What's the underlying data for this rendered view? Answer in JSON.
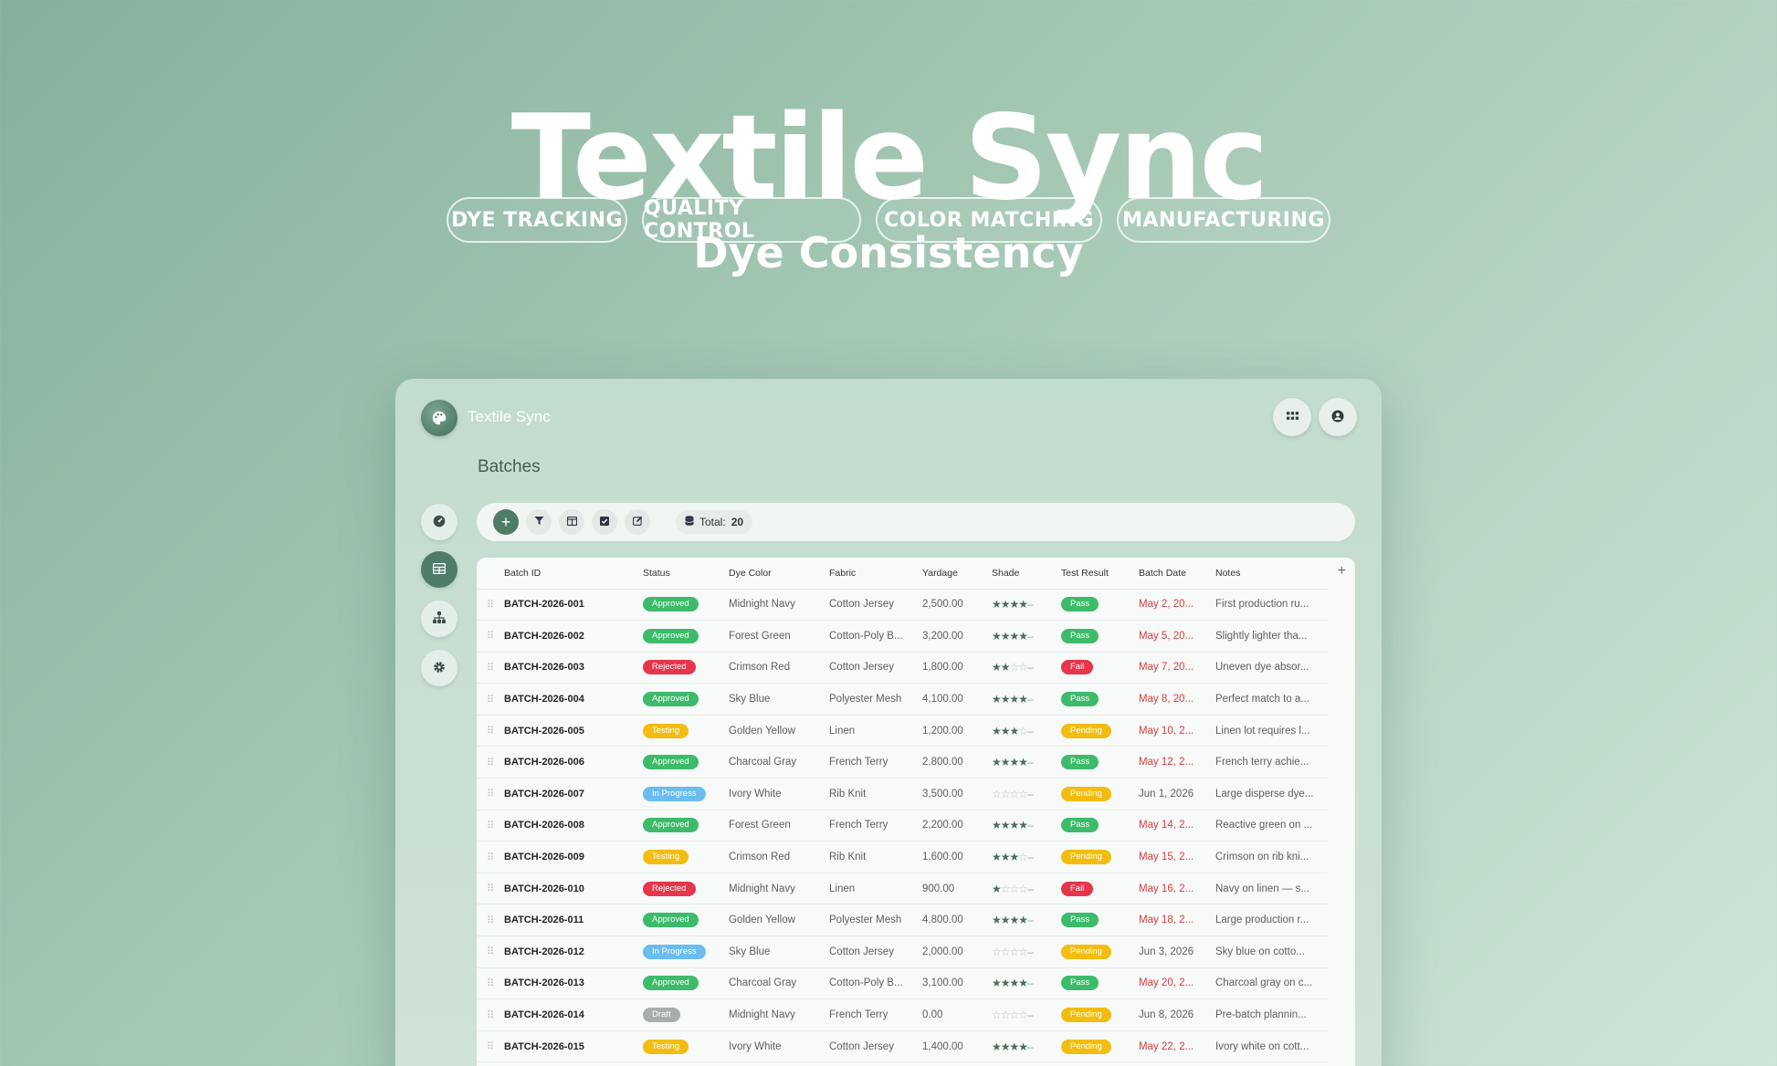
{
  "hero": {
    "title": "Textile Sync",
    "subtitle": "Dye Consistency",
    "tags": [
      "DYE TRACKING",
      "QUALITY CONTROL",
      "COLOR MATCHING",
      "MANUFACTURING"
    ]
  },
  "app": {
    "name": "Textile Sync",
    "page_title": "Batches",
    "total_label": "Total:",
    "total_value": "20",
    "add_column_label": "+"
  },
  "icons": {
    "logo": "palette-icon",
    "apps": "grid-icon",
    "account": "user-circle-icon",
    "sidebar": [
      "dashboard-icon",
      "table-icon",
      "hierarchy-icon",
      "settings-icon"
    ],
    "toolbar": [
      "plus-icon",
      "filter-icon",
      "columns-icon",
      "checkbox-icon",
      "edit-icon"
    ],
    "total": "database-icon"
  },
  "colors": {
    "accent": "#4f7c66",
    "Approved": "#3dbb6a",
    "Rejected": "#e5364b",
    "Testing": "#f2bd10",
    "In Progress": "#6bbcef",
    "Draft": "#a8aeaa",
    "Pass": "#3dbb6a",
    "Fail": "#e5364b",
    "Pending": "#f2bd10",
    "overdue_date": "#d83b3b"
  },
  "table": {
    "columns": [
      "Batch ID",
      "Status",
      "Dye Color",
      "Fabric",
      "Yardage",
      "Shade",
      "Test Result",
      "Batch Date",
      "Notes"
    ],
    "rows": [
      {
        "id": "BATCH-2026-001",
        "status": "Approved",
        "color": "Midnight Navy",
        "fabric": "Cotton Jersey",
        "yardage": "2,500.00",
        "shade": 4,
        "result": "Pass",
        "date": "May 2, 20...",
        "date_overdue": true,
        "notes": "First production ru..."
      },
      {
        "id": "BATCH-2026-002",
        "status": "Approved",
        "color": "Forest Green",
        "fabric": "Cotton-Poly B...",
        "yardage": "3,200.00",
        "shade": 4,
        "result": "Pass",
        "date": "May 5, 20...",
        "date_overdue": true,
        "notes": "Slightly lighter tha..."
      },
      {
        "id": "BATCH-2026-003",
        "status": "Rejected",
        "color": "Crimson Red",
        "fabric": "Cotton Jersey",
        "yardage": "1,800.00",
        "shade": 2,
        "result": "Fail",
        "date": "May 7, 20...",
        "date_overdue": true,
        "notes": "Uneven dye absor..."
      },
      {
        "id": "BATCH-2026-004",
        "status": "Approved",
        "color": "Sky Blue",
        "fabric": "Polyester Mesh",
        "yardage": "4,100.00",
        "shade": 4,
        "result": "Pass",
        "date": "May 8, 20...",
        "date_overdue": true,
        "notes": "Perfect match to a..."
      },
      {
        "id": "BATCH-2026-005",
        "status": "Testing",
        "color": "Golden Yellow",
        "fabric": "Linen",
        "yardage": "1,200.00",
        "shade": 3,
        "result": "Pending",
        "date": "May 10, 2...",
        "date_overdue": true,
        "notes": "Linen lot requires l..."
      },
      {
        "id": "BATCH-2026-006",
        "status": "Approved",
        "color": "Charcoal Gray",
        "fabric": "French Terry",
        "yardage": "2,800.00",
        "shade": 4,
        "result": "Pass",
        "date": "May 12, 2...",
        "date_overdue": true,
        "notes": "French terry achie..."
      },
      {
        "id": "BATCH-2026-007",
        "status": "In Progress",
        "color": "Ivory White",
        "fabric": "Rib Knit",
        "yardage": "3,500.00",
        "shade": 0,
        "result": "Pending",
        "date": "Jun 1, 2026",
        "date_overdue": false,
        "notes": "Large disperse dye..."
      },
      {
        "id": "BATCH-2026-008",
        "status": "Approved",
        "color": "Forest Green",
        "fabric": "French Terry",
        "yardage": "2,200.00",
        "shade": 4,
        "result": "Pass",
        "date": "May 14, 2...",
        "date_overdue": true,
        "notes": "Reactive green on ..."
      },
      {
        "id": "BATCH-2026-009",
        "status": "Testing",
        "color": "Crimson Red",
        "fabric": "Rib Knit",
        "yardage": "1,600.00",
        "shade": 3,
        "result": "Pending",
        "date": "May 15, 2...",
        "date_overdue": true,
        "notes": "Crimson on rib kni..."
      },
      {
        "id": "BATCH-2026-010",
        "status": "Rejected",
        "color": "Midnight Navy",
        "fabric": "Linen",
        "yardage": "900.00",
        "shade": 1,
        "result": "Fail",
        "date": "May 16, 2...",
        "date_overdue": true,
        "notes": "Navy on linen — s..."
      },
      {
        "id": "BATCH-2026-011",
        "status": "Approved",
        "color": "Golden Yellow",
        "fabric": "Polyester Mesh",
        "yardage": "4,800.00",
        "shade": 4,
        "result": "Pass",
        "date": "May 18, 2...",
        "date_overdue": true,
        "notes": "Large production r..."
      },
      {
        "id": "BATCH-2026-012",
        "status": "In Progress",
        "color": "Sky Blue",
        "fabric": "Cotton Jersey",
        "yardage": "2,000.00",
        "shade": 0,
        "result": "Pending",
        "date": "Jun 3, 2026",
        "date_overdue": false,
        "notes": "Sky blue on cotto..."
      },
      {
        "id": "BATCH-2026-013",
        "status": "Approved",
        "color": "Charcoal Gray",
        "fabric": "Cotton-Poly B...",
        "yardage": "3,100.00",
        "shade": 4,
        "result": "Pass",
        "date": "May 20, 2...",
        "date_overdue": true,
        "notes": "Charcoal gray on c..."
      },
      {
        "id": "BATCH-2026-014",
        "status": "Draft",
        "color": "Midnight Navy",
        "fabric": "French Terry",
        "yardage": "0.00",
        "shade": 0,
        "result": "Pending",
        "date": "Jun 8, 2026",
        "date_overdue": false,
        "notes": "Pre-batch plannin..."
      },
      {
        "id": "BATCH-2026-015",
        "status": "Testing",
        "color": "Ivory White",
        "fabric": "Cotton Jersey",
        "yardage": "1,400.00",
        "shade": 4,
        "result": "Pending",
        "date": "May 22, 2...",
        "date_overdue": true,
        "notes": "Ivory white on cott..."
      }
    ]
  }
}
